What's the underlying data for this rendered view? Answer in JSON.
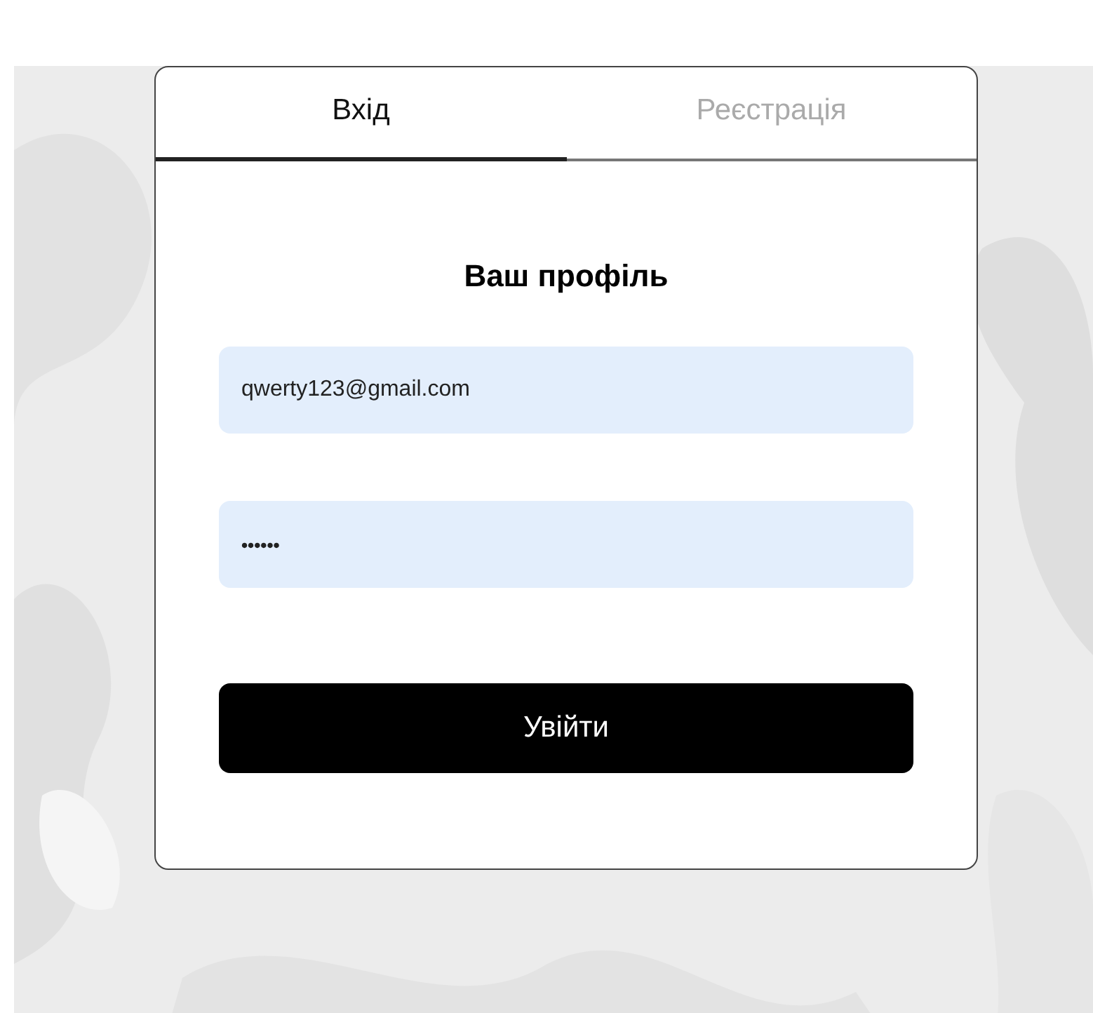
{
  "tabs": [
    {
      "label": "Вхід",
      "selected": true
    },
    {
      "label": "Реєстрація",
      "selected": false
    }
  ],
  "form": {
    "title": "Ваш профіль",
    "fields": [
      {
        "kind": "email",
        "value": "qwerty123@gmail.com"
      },
      {
        "kind": "password",
        "value": "••••••"
      }
    ],
    "submit": "Увійти"
  }
}
